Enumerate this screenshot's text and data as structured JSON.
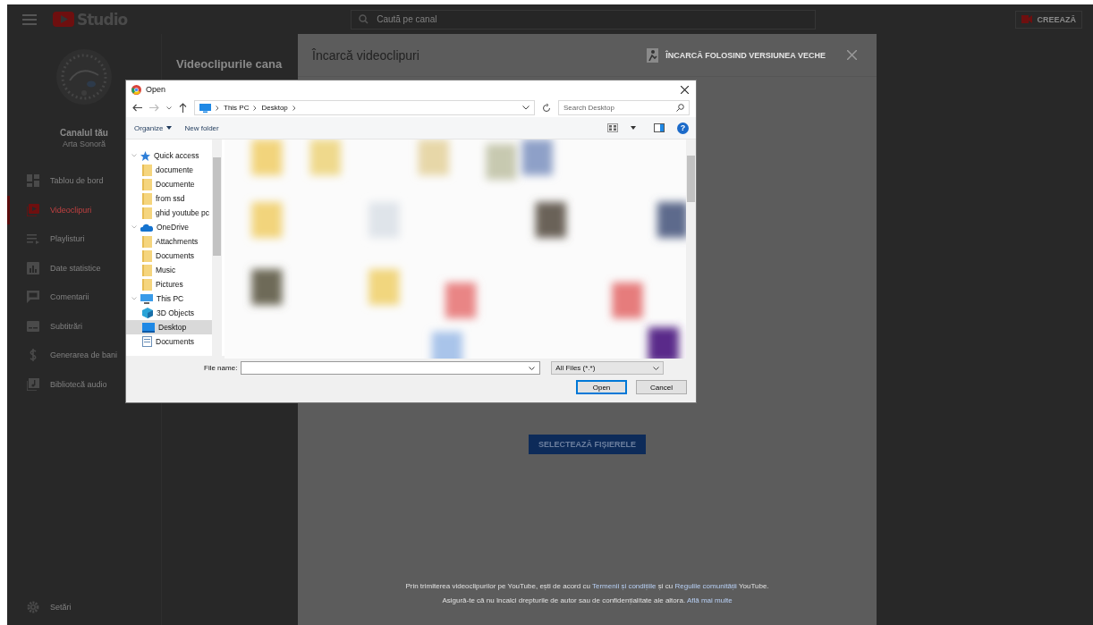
{
  "topbar": {
    "logo": "Studio",
    "search": {
      "placeholder": "Caută pe canal"
    },
    "create_button": "CREEAZĂ"
  },
  "sidebar": {
    "channel_label": "Canalul tău",
    "channel_name": "Arta Sonoră",
    "items": [
      {
        "label": "Tablou de bord",
        "selected": false
      },
      {
        "label": "Videoclipuri",
        "selected": true
      },
      {
        "label": "Playlisturi",
        "selected": false
      },
      {
        "label": "Date statistice",
        "selected": false
      },
      {
        "label": "Comentarii",
        "selected": false
      },
      {
        "label": "Subtitrări",
        "selected": false
      },
      {
        "label": "Generarea de bani",
        "selected": false
      },
      {
        "label": "Bibliotecă audio",
        "selected": false
      }
    ],
    "settings": "Setări"
  },
  "page": {
    "title": "Videoclipurile cana"
  },
  "upload_modal": {
    "title": "Încarcă videoclipuri",
    "legacy_button": "ÎNCARCĂ FOLOSIND VERSIUNEA VECHE",
    "select_button": "SELECTEAZĂ FIȘIERELE",
    "terms": [
      [
        {
          "kind": "text",
          "text": "Prin trimiterea videoclipurilor pe YouTube, ești de acord cu "
        },
        {
          "kind": "link",
          "text": "Termenii și condițiile"
        },
        {
          "kind": "text",
          "text": " și cu "
        },
        {
          "kind": "link",
          "text": "Regulile comunității"
        },
        {
          "kind": "text",
          "text": " YouTube."
        }
      ],
      [
        {
          "kind": "text",
          "text": "Asigură-te că nu încalci drepturile de autor sau de confidențialitate ale altora. "
        },
        {
          "kind": "link",
          "text": "Află mai multe"
        }
      ]
    ]
  },
  "open_dialog": {
    "title": "Open",
    "breadcrumb": [
      "This PC",
      "Desktop"
    ],
    "search": {
      "placeholder": "Search Desktop"
    },
    "toolbar": {
      "organize": "Organize",
      "new_folder": "New folder",
      "help": "?"
    },
    "tree": [
      {
        "label": "Quick access",
        "kind": "star",
        "expanded": true,
        "selected": false,
        "children": [
          {
            "label": "documente",
            "kind": "folder",
            "selected": false
          },
          {
            "label": "Documente",
            "kind": "folder",
            "selected": false
          },
          {
            "label": "from ssd",
            "kind": "folder",
            "selected": false
          },
          {
            "label": "ghid youtube pc",
            "kind": "folder",
            "selected": false
          }
        ]
      },
      {
        "label": "OneDrive",
        "kind": "cloud",
        "expanded": true,
        "selected": false,
        "children": [
          {
            "label": "Attachments",
            "kind": "folder",
            "selected": false
          },
          {
            "label": "Documents",
            "kind": "folder",
            "selected": false
          },
          {
            "label": "Music",
            "kind": "folder",
            "selected": false
          },
          {
            "label": "Pictures",
            "kind": "folder",
            "selected": false
          }
        ]
      },
      {
        "label": "This PC",
        "kind": "pc",
        "expanded": true,
        "selected": false,
        "children": [
          {
            "label": "3D Objects",
            "kind": "cube",
            "selected": false
          },
          {
            "label": "Desktop",
            "kind": "desktop",
            "selected": true
          },
          {
            "label": "Documents",
            "kind": "doc",
            "selected": false
          }
        ]
      }
    ],
    "file_name_label": "File name:",
    "file_type": "All Files (*.*)",
    "buttons": [
      {
        "label": "Open",
        "kind": "primary"
      },
      {
        "label": "Cancel",
        "kind": "normal"
      }
    ]
  }
}
